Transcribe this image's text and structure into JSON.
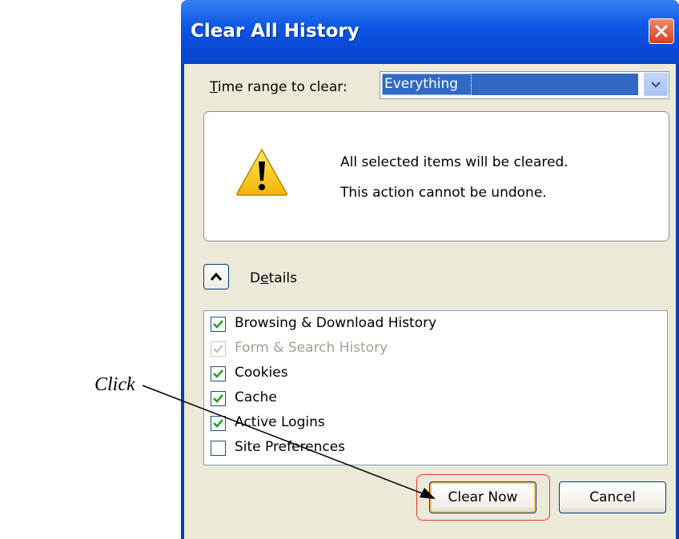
{
  "annotation": {
    "click_label": "Click"
  },
  "dialog": {
    "title": "Clear All History",
    "time_range": {
      "label_underlined": "T",
      "label_rest": "ime range to clear:",
      "value": "Everything"
    },
    "warning": {
      "line1": "All selected items will be cleared.",
      "line2": "This action cannot be undone."
    },
    "details": {
      "label_pre": "D",
      "label_ul": "e",
      "label_post": "tails"
    },
    "items": [
      {
        "label": "Browsing & Download History",
        "checked": true,
        "disabled": false
      },
      {
        "label": "Form & Search History",
        "checked": true,
        "disabled": true
      },
      {
        "label": "Cookies",
        "checked": true,
        "disabled": false
      },
      {
        "label": "Cache",
        "checked": true,
        "disabled": false
      },
      {
        "label": "Active Logins",
        "checked": true,
        "disabled": false
      },
      {
        "label": "Site Preferences",
        "checked": false,
        "disabled": false
      }
    ],
    "buttons": {
      "clear_now": "Clear Now",
      "cancel": "Cancel"
    }
  },
  "colors": {
    "titlebar": "#0a4fd9",
    "highlight": "#e8342a",
    "check": "#21a121"
  }
}
